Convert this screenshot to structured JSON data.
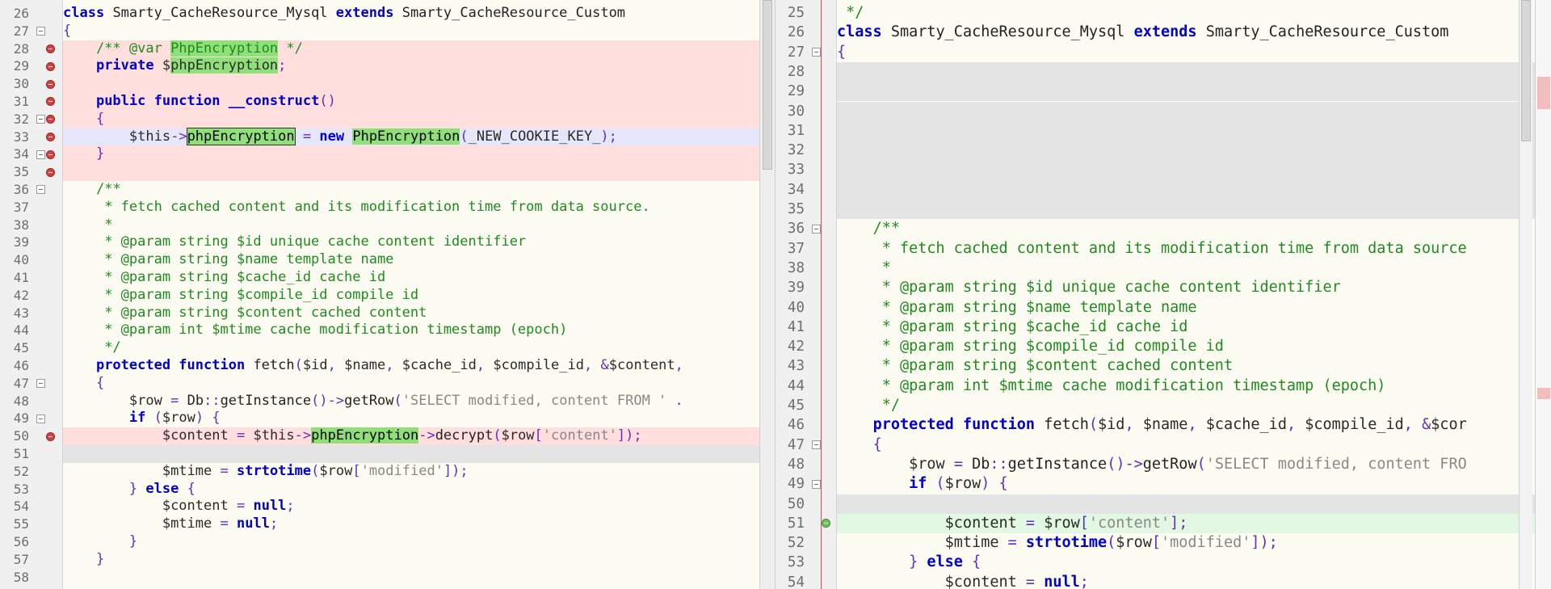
{
  "left": {
    "lines": [
      {
        "n": "26",
        "bg": "",
        "mark": "",
        "html": "<span class='kw'>class</span> <span class='plain'>Smarty_CacheResource_Mysql</span> <span class='kw'>extends</span> <span class='plain'>Smarty_CacheResource_Custom</span>"
      },
      {
        "n": "27",
        "bg": "",
        "mark": "fold",
        "html": "<span class='op'>{</span>"
      },
      {
        "n": "28",
        "bg": "del",
        "mark": "bp",
        "html": "    <span class='cmt'>/** @var <span class='hl'>PhpEncryption</span> */</span>"
      },
      {
        "n": "29",
        "bg": "del",
        "mark": "bp",
        "html": "    <span class='kw'>private</span> <span class='var'>$<span class='hl'>phpEncryption</span></span><span class='op'>;</span>"
      },
      {
        "n": "30",
        "bg": "del",
        "mark": "bp",
        "html": ""
      },
      {
        "n": "31",
        "bg": "del",
        "mark": "bp",
        "html": "    <span class='kw'>public function</span> <span class='kw'>__construct</span><span class='op'>()</span>"
      },
      {
        "n": "32",
        "bg": "del",
        "mark": "bpfold",
        "html": "    <span class='op'>{</span>"
      },
      {
        "n": "33",
        "bg": "mod",
        "mark": "bp",
        "html": "        <span class='var'>$this</span><span class='op'>-></span><span class='hl-border'>phpEncryption</span> <span class='op'>=</span> <span class='kw'>new</span> <span class='hl'>PhpEncryption</span><span class='op'>(</span><span class='var'>_NEW_COOKIE_KEY_</span><span class='op'>);</span>"
      },
      {
        "n": "34",
        "bg": "del",
        "mark": "bpfold",
        "html": "    <span class='op'>}</span>"
      },
      {
        "n": "35",
        "bg": "del",
        "mark": "bp",
        "html": ""
      },
      {
        "n": "36",
        "bg": "",
        "mark": "fold",
        "html": "    <span class='cmt'>/**</span>"
      },
      {
        "n": "37",
        "bg": "",
        "mark": "",
        "html": "     <span class='cmt'>* fetch cached content and its modification time from data source.</span>"
      },
      {
        "n": "38",
        "bg": "",
        "mark": "",
        "html": "     <span class='cmt'>*</span>"
      },
      {
        "n": "39",
        "bg": "",
        "mark": "",
        "html": "     <span class='cmt'>* @param string $id unique cache content identifier</span>"
      },
      {
        "n": "40",
        "bg": "",
        "mark": "",
        "html": "     <span class='cmt'>* @param string $name template name</span>"
      },
      {
        "n": "41",
        "bg": "",
        "mark": "",
        "html": "     <span class='cmt'>* @param string $cache_id cache id</span>"
      },
      {
        "n": "42",
        "bg": "",
        "mark": "",
        "html": "     <span class='cmt'>* @param string $compile_id compile id</span>"
      },
      {
        "n": "43",
        "bg": "",
        "mark": "",
        "html": "     <span class='cmt'>* @param string $content cached content</span>"
      },
      {
        "n": "44",
        "bg": "",
        "mark": "",
        "html": "     <span class='cmt'>* @param int $mtime cache modification timestamp (epoch)</span>"
      },
      {
        "n": "45",
        "bg": "",
        "mark": "",
        "html": "     <span class='cmt'>*/</span>"
      },
      {
        "n": "46",
        "bg": "",
        "mark": "",
        "html": "    <span class='kw'>protected function</span> <span class='plain'>fetch</span><span class='op'>(</span><span class='var'>$id</span><span class='op'>,</span> <span class='var'>$name</span><span class='op'>,</span> <span class='var'>$cache_id</span><span class='op'>,</span> <span class='var'>$compile_id</span><span class='op'>,</span> <span class='op'>&amp;</span><span class='var'>$content</span><span class='op'>,</span>"
      },
      {
        "n": "47",
        "bg": "",
        "mark": "fold",
        "html": "    <span class='op'>{</span>"
      },
      {
        "n": "48",
        "bg": "",
        "mark": "",
        "html": "        <span class='var'>$row</span> <span class='op'>=</span> <span class='plain'>Db</span><span class='op'>::</span><span class='plain'>getInstance</span><span class='op'>()-></span><span class='plain'>getRow</span><span class='op'>(</span><span class='str'>'SELECT modified, content FROM '</span> <span class='op'>.</span>"
      },
      {
        "n": "49",
        "bg": "",
        "mark": "fold",
        "html": "        <span class='kw'>if</span> <span class='op'>(</span><span class='var'>$row</span><span class='op'>)</span> <span class='op'>{</span>"
      },
      {
        "n": "50",
        "bg": "del",
        "mark": "bp",
        "html": "            <span class='var'>$content</span> <span class='op'>=</span> <span class='var'>$this</span><span class='op'>-></span><span class='hl'>phpEncryption</span><span class='op'>-></span><span class='plain'>decrypt</span><span class='op'>(</span><span class='var'>$row</span><span class='op'>[</span><span class='str'>'content'</span><span class='op'>]);</span>"
      },
      {
        "n": "51",
        "bg": "gray",
        "mark": "",
        "html": ""
      },
      {
        "n": "52",
        "bg": "",
        "mark": "",
        "html": "            <span class='var'>$mtime</span> <span class='op'>=</span> <span class='kw'>strtotime</span><span class='op'>(</span><span class='var'>$row</span><span class='op'>[</span><span class='str'>'modified'</span><span class='op'>]);</span>"
      },
      {
        "n": "53",
        "bg": "",
        "mark": "",
        "html": "        <span class='op'>}</span> <span class='kw'>else</span> <span class='op'>{</span>"
      },
      {
        "n": "54",
        "bg": "",
        "mark": "",
        "html": "            <span class='var'>$content</span> <span class='op'>=</span> <span class='kw'>null</span><span class='op'>;</span>"
      },
      {
        "n": "55",
        "bg": "",
        "mark": "",
        "html": "            <span class='var'>$mtime</span> <span class='op'>=</span> <span class='kw'>null</span><span class='op'>;</span>"
      },
      {
        "n": "56",
        "bg": "",
        "mark": "",
        "html": "        <span class='op'>}</span>"
      },
      {
        "n": "57",
        "bg": "",
        "mark": "",
        "html": "    <span class='op'>}</span>"
      },
      {
        "n": "58",
        "bg": "",
        "mark": "",
        "html": ""
      }
    ]
  },
  "right": {
    "lines": [
      {
        "n": "25",
        "bg": "",
        "mark": "",
        "html": " <span class='cmt'>*/</span>"
      },
      {
        "n": "26",
        "bg": "",
        "mark": "",
        "html": "<span class='kw'>class</span> <span class='plain'>Smarty_CacheResource_Mysql</span> <span class='kw'>extends</span> <span class='plain'>Smarty_CacheResource_Custom</span>"
      },
      {
        "n": "27",
        "bg": "",
        "mark": "fold",
        "html": "<span class='op'>{</span>"
      },
      {
        "n": "28",
        "bg": "gray",
        "mark": "",
        "html": ""
      },
      {
        "n": "29",
        "bg": "gray",
        "mark": "",
        "html": ""
      },
      {
        "n": "30",
        "bg": "gray",
        "mark": "",
        "html": ""
      },
      {
        "n": "31",
        "bg": "gray",
        "mark": "",
        "html": ""
      },
      {
        "n": "32",
        "bg": "gray",
        "mark": "",
        "html": ""
      },
      {
        "n": "33",
        "bg": "gray",
        "mark": "",
        "html": ""
      },
      {
        "n": "34",
        "bg": "gray",
        "mark": "",
        "html": ""
      },
      {
        "n": "35",
        "bg": "gray",
        "mark": "",
        "html": ""
      },
      {
        "n": "36",
        "bg": "",
        "mark": "fold",
        "html": "    <span class='cmt'>/**</span>"
      },
      {
        "n": "37",
        "bg": "",
        "mark": "",
        "html": "     <span class='cmt'>* fetch cached content and its modification time from data source</span>"
      },
      {
        "n": "38",
        "bg": "",
        "mark": "",
        "html": "     <span class='cmt'>*</span>"
      },
      {
        "n": "39",
        "bg": "",
        "mark": "",
        "html": "     <span class='cmt'>* @param string $id unique cache content identifier</span>"
      },
      {
        "n": "40",
        "bg": "",
        "mark": "",
        "html": "     <span class='cmt'>* @param string $name template name</span>"
      },
      {
        "n": "41",
        "bg": "",
        "mark": "",
        "html": "     <span class='cmt'>* @param string $cache_id cache id</span>"
      },
      {
        "n": "42",
        "bg": "",
        "mark": "",
        "html": "     <span class='cmt'>* @param string $compile_id compile id</span>"
      },
      {
        "n": "43",
        "bg": "",
        "mark": "",
        "html": "     <span class='cmt'>* @param string $content cached content</span>"
      },
      {
        "n": "44",
        "bg": "",
        "mark": "",
        "html": "     <span class='cmt'>* @param int $mtime cache modification timestamp (epoch)</span>"
      },
      {
        "n": "45",
        "bg": "",
        "mark": "",
        "html": "     <span class='cmt'>*/</span>"
      },
      {
        "n": "46",
        "bg": "",
        "mark": "",
        "html": "    <span class='kw'>protected function</span> <span class='plain'>fetch</span><span class='op'>(</span><span class='var'>$id</span><span class='op'>,</span> <span class='var'>$name</span><span class='op'>,</span> <span class='var'>$cache_id</span><span class='op'>,</span> <span class='var'>$compile_id</span><span class='op'>,</span> <span class='op'>&amp;</span><span class='var'>$cor</span>"
      },
      {
        "n": "47",
        "bg": "",
        "mark": "fold",
        "html": "    <span class='op'>{</span>"
      },
      {
        "n": "48",
        "bg": "",
        "mark": "",
        "html": "        <span class='var'>$row</span> <span class='op'>=</span> <span class='plain'>Db</span><span class='op'>::</span><span class='plain'>getInstance</span><span class='op'>()-></span><span class='plain'>getRow</span><span class='op'>(</span><span class='str'>'SELECT modified, content FRO</span>"
      },
      {
        "n": "49",
        "bg": "",
        "mark": "fold",
        "html": "        <span class='kw'>if</span> <span class='op'>(</span><span class='var'>$row</span><span class='op'>)</span> <span class='op'>{</span>"
      },
      {
        "n": "50",
        "bg": "gray",
        "mark": "",
        "html": ""
      },
      {
        "n": "51",
        "bg": "add",
        "mark": "add",
        "html": "            <span class='var'>$content</span> <span class='op'>=</span> <span class='var'>$row</span><span class='op'>[</span><span class='str'>'content'</span><span class='op'>];</span>"
      },
      {
        "n": "52",
        "bg": "",
        "mark": "",
        "html": "            <span class='var'>$mtime</span> <span class='op'>=</span> <span class='kw'>strtotime</span><span class='op'>(</span><span class='var'>$row</span><span class='op'>[</span><span class='str'>'modified'</span><span class='op'>]);</span>"
      },
      {
        "n": "53",
        "bg": "",
        "mark": "",
        "html": "        <span class='op'>}</span> <span class='kw'>else</span> <span class='op'>{</span>"
      },
      {
        "n": "54",
        "bg": "",
        "mark": "",
        "html": "            <span class='var'>$content</span> <span class='op'>=</span> <span class='kw'>null</span><span class='op'>;</span>"
      }
    ]
  }
}
